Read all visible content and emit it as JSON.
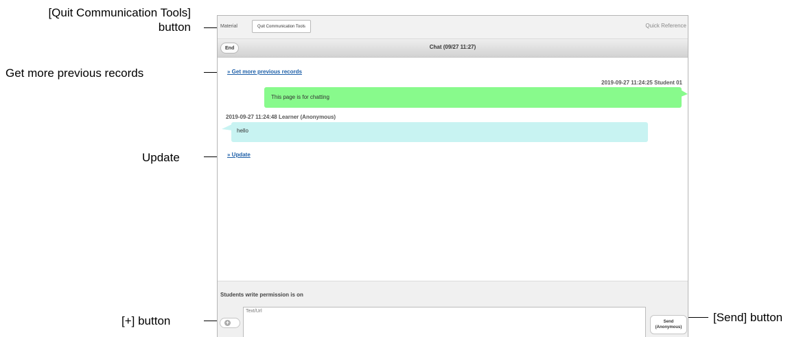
{
  "callouts": {
    "quit_line1": "[Quit Communication Tools]",
    "quit_line2": "button",
    "get_more": "Get more previous records",
    "update": "Update",
    "plus": "[+]  button",
    "send": "[Send] button"
  },
  "topbar": {
    "material_tab": "Material",
    "quit_button": "Quit Communication Tools",
    "quick_reference": "Quick Reference"
  },
  "chatbar": {
    "end_button": "End",
    "title": "Chat  (09/27 11:27)"
  },
  "chat": {
    "get_more_link": "» Get more previous records",
    "messages": [
      {
        "meta": "2019-09-27 11:24:25 Student 01",
        "text": "This page is for chatting",
        "color": "#88fa8c"
      },
      {
        "meta": "2019-09-27 11:24:48 Learner (Anonymous)",
        "text": "hello",
        "color": "#c8f3f2"
      }
    ],
    "update_link": "» Update"
  },
  "footer": {
    "permission": "Students write permission is on",
    "input_placeholder": "Text/Url",
    "send_line1": "Send",
    "send_line2": "(Anonymous)"
  }
}
